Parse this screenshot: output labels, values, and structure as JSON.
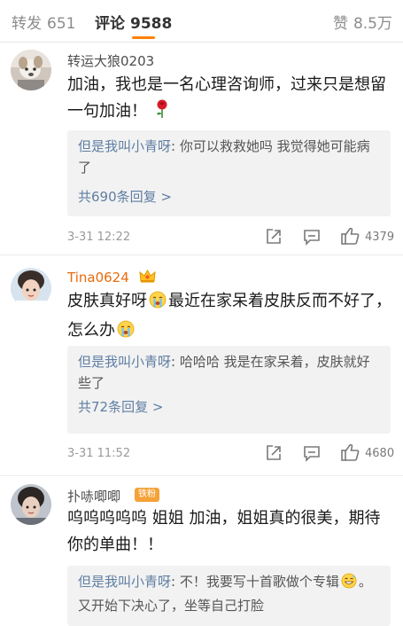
{
  "tabs": {
    "repost": {
      "label": "转发",
      "count": "651"
    },
    "comment": {
      "label": "评论",
      "count": "9588"
    },
    "like": {
      "label": "赞",
      "count": "8.5万"
    }
  },
  "accent_color": "#ff8200",
  "comments": [
    {
      "username": "转运大狼0203",
      "text": "加油，我也是一名心理咨询师，过来只是想留一句加油！",
      "emoji": "rose-icon",
      "reply": {
        "user": "但是我叫小青呀",
        "text": ": 你可以救救她吗 我觉得她可能病了",
        "more": "共690条回复 >"
      },
      "time": "3-31 12:22",
      "likes": "4379"
    },
    {
      "username": "Tina0624",
      "badge": "crown-icon",
      "text_part1": "皮肤真好呀",
      "text_part2": "最近在家呆着皮肤反而不好了，怎么办",
      "emoji": "crying-face-icon",
      "reply": {
        "user": "但是我叫小青呀",
        "text": ": 哈哈哈 我是在家呆着，皮肤就好些了",
        "more": "共72条回复 >"
      },
      "time": "3-31 11:52",
      "likes": "4680"
    },
    {
      "username": "扑哧唧唧",
      "badge_label": "铁粉",
      "text": "呜呜呜呜呜 姐姐 加油，姐姐真的很美，期待你的单曲！！",
      "reply": {
        "user": "但是我叫小青呀",
        "text_part1": ": 不！我要写十首歌做个专辑",
        "text_part2": "。又开始下决心了，坐等自己打脸",
        "emoji": "grin-sweat-icon"
      }
    }
  ]
}
